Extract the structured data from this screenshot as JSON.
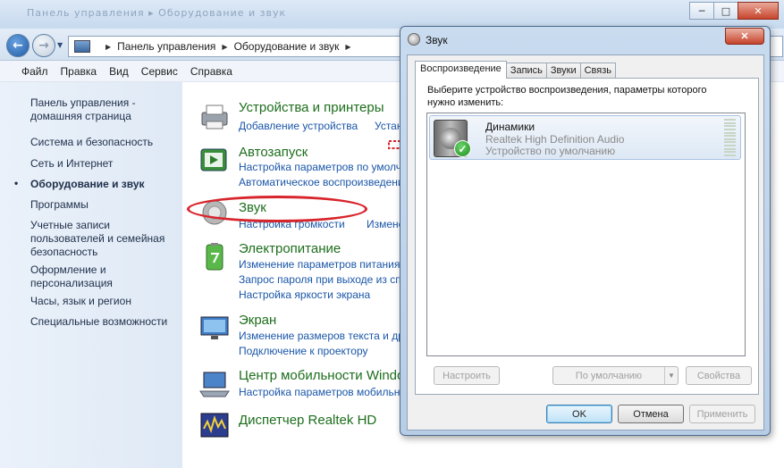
{
  "window": {
    "title_blur": "Панель управления ▸ Оборудование и звук",
    "controls": {
      "minimize": "─",
      "maximize": "□",
      "close": "✕"
    }
  },
  "address": {
    "crumbs": [
      "Панель управления",
      "Оборудование и звук"
    ]
  },
  "menu": [
    "Файл",
    "Правка",
    "Вид",
    "Сервис",
    "Справка"
  ],
  "sidebar": {
    "items": [
      "Панель управления - домашняя страница",
      "Система и безопасность",
      "Сеть и Интернет",
      "Оборудование и звук",
      "Программы",
      "Учетные записи пользователей и семейная безопасность",
      "Оформление и персонализация",
      "Часы, язык и регион",
      "Специальные возможности"
    ],
    "bullet": "•"
  },
  "categories": [
    {
      "title": "Устройства и принтеры",
      "links": [
        "Добавление устройства",
        "Устан"
      ]
    },
    {
      "title": "Автозапуск",
      "links": [
        "Настройка параметров по умолча",
        "Автоматическое воспроизведени"
      ]
    },
    {
      "title": "Звук",
      "links": [
        "Настройка громкости",
        "Изменен"
      ]
    },
    {
      "title": "Электропитание",
      "links": [
        "Изменение параметров питания",
        "Запрос пароля при выходе из сп",
        "Настройка яркости экрана"
      ]
    },
    {
      "title": "Экран",
      "links": [
        "Изменение размеров текста и дру",
        "Подключение к проектору"
      ]
    },
    {
      "title": "Центр мобильности Windo",
      "links": [
        "Настройка параметров мобильно"
      ]
    },
    {
      "title": "Диспетчер Realtek HD",
      "links": []
    }
  ],
  "dialog": {
    "title": "Звук",
    "close": "✕",
    "tabs": [
      "Воспроизведение",
      "Запись",
      "Звуки",
      "Связь"
    ],
    "instruction": "Выберите устройство воспроизведения, параметры которого нужно изменить:",
    "device": {
      "name": "Динамики",
      "driver": "Realtek High Definition Audio",
      "status": "Устройство по умолчанию",
      "check": "✓"
    },
    "buttons": {
      "configure": "Настроить",
      "default": "По умолчанию",
      "properties": "Свойства",
      "ok": "OK",
      "cancel": "Отмена",
      "apply": "Применить"
    }
  },
  "colors": {
    "category_title": "#1d6e1d",
    "link": "#1a56a8",
    "annotation_red": "#d8242b"
  }
}
